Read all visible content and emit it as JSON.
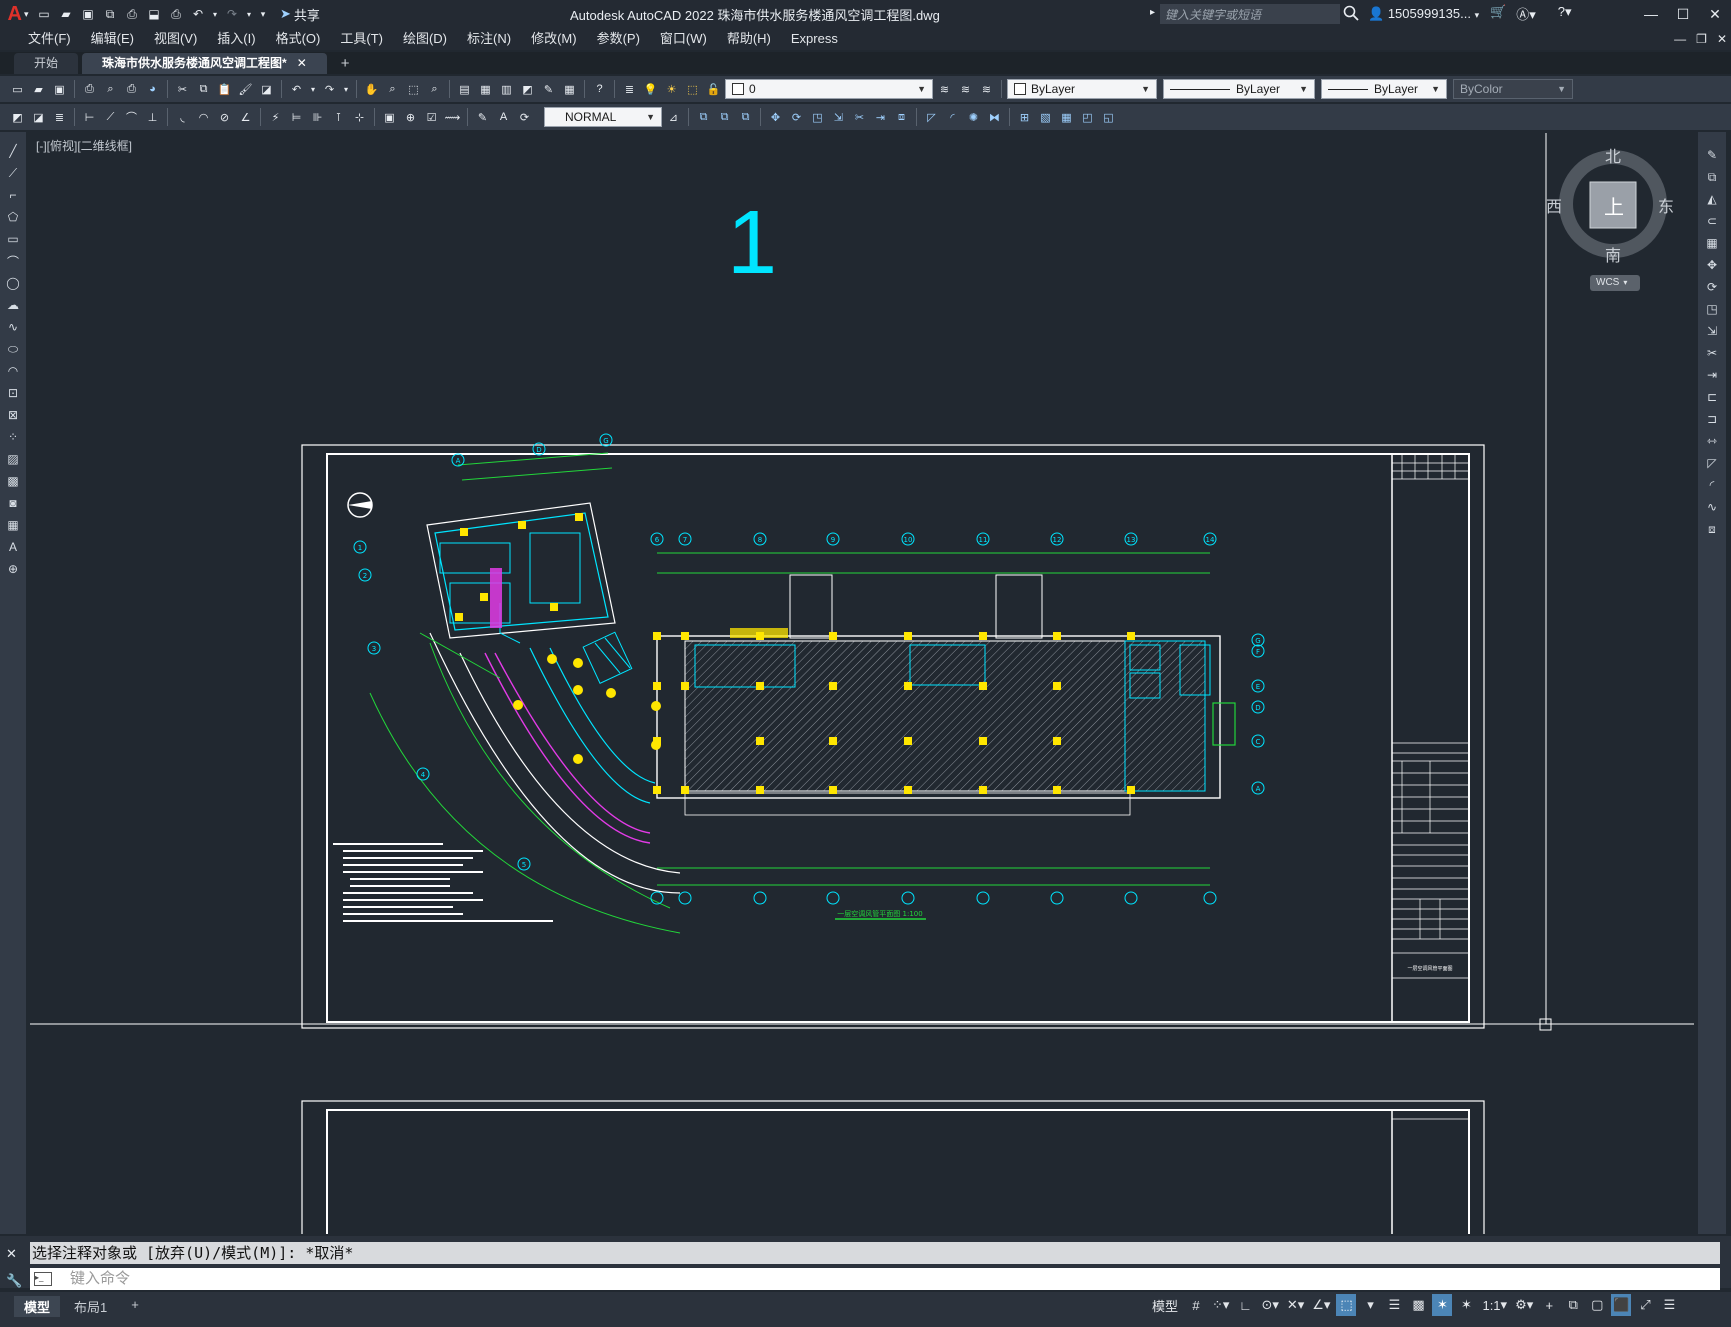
{
  "title_bar": {
    "app_title": "Autodesk AutoCAD 2022    珠海市供水服务楼通风空调工程图.dwg",
    "share_label": "共享",
    "search_placeholder": "键入关键字或短语",
    "user_label": "1505999135..."
  },
  "menu": [
    "文件(F)",
    "编辑(E)",
    "视图(V)",
    "插入(I)",
    "格式(O)",
    "工具(T)",
    "绘图(D)",
    "标注(N)",
    "修改(M)",
    "参数(P)",
    "窗口(W)",
    "帮助(H)",
    "Express"
  ],
  "tabs": {
    "start": "开始",
    "drawing": "珠海市供水服务楼通风空调工程图*",
    "close_glyph": "✕",
    "add_glyph": "+"
  },
  "toolbar1": {
    "layer_value": "0",
    "color_value": "ByLayer",
    "linetype_value": "ByLayer",
    "lineweight_value": "ByLayer",
    "plotstyle_value": "ByColor"
  },
  "toolbar2": {
    "dimstyle_value": "NORMAL"
  },
  "viewport": {
    "label": "[-][俯视][二维线框]",
    "big_number": "1"
  },
  "viewcube": {
    "north": "北",
    "south": "南",
    "east": "东",
    "west": "西",
    "top_face": "上",
    "wcs_label": "WCS"
  },
  "command": {
    "history": "选择注释对象或 [放弃(U)/模式(M)]: *取消*",
    "input_placeholder": "键入命令"
  },
  "layout_tabs": [
    "模型",
    "布局1"
  ],
  "status": {
    "model_label": "模型",
    "scale_label": "1:1"
  },
  "drawing": {
    "grid_top": [
      "6",
      "7",
      "8",
      "9",
      "10",
      "11",
      "12",
      "13",
      "14"
    ],
    "grid_left": [
      "1",
      "2",
      "3",
      "4",
      "5"
    ],
    "grid_right": [
      "G",
      "F",
      "E",
      "D",
      "C",
      "A"
    ],
    "grid_arc_top": [
      "A",
      "D",
      "G"
    ],
    "plan_title": "一层空调风管平面图  1:100",
    "titleblock_caption": "一层空调风管平面图"
  },
  "colors": {
    "accent": "#4c85b6",
    "cad_green": "#22d63a",
    "cad_cyan": "#00e5ff",
    "cad_yellow": "#ffe600",
    "cad_magenta": "#e23be6",
    "cad_white": "#ffffff"
  }
}
